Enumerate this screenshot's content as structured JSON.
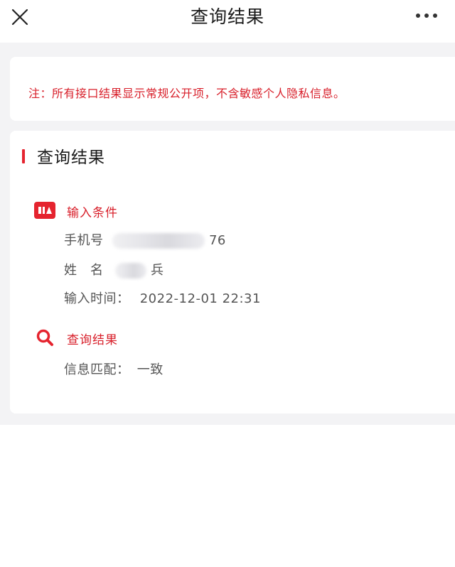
{
  "header": {
    "title": "查询结果"
  },
  "notice": {
    "text": "注：所有接口结果显示常规公开项，不含敏感个人隐私信息。"
  },
  "result_section": {
    "title": "查询结果",
    "input_block": {
      "title": "输入条件",
      "phone": {
        "label": "手机号",
        "value_suffix": "76"
      },
      "name": {
        "label": "姓　名",
        "value_suffix": "兵"
      },
      "time": {
        "label": "输入时间：",
        "value": "2022-12-01 22:31"
      }
    },
    "query_block": {
      "title": "查询结果",
      "match": {
        "label": "信息匹配：",
        "value": "一致"
      }
    }
  },
  "icons": {
    "close": "close-icon",
    "more": "more-icon",
    "input": "id-card-icon",
    "query": "search-icon"
  },
  "colors": {
    "accent": "#e5242f",
    "notice": "#d81f2a"
  }
}
